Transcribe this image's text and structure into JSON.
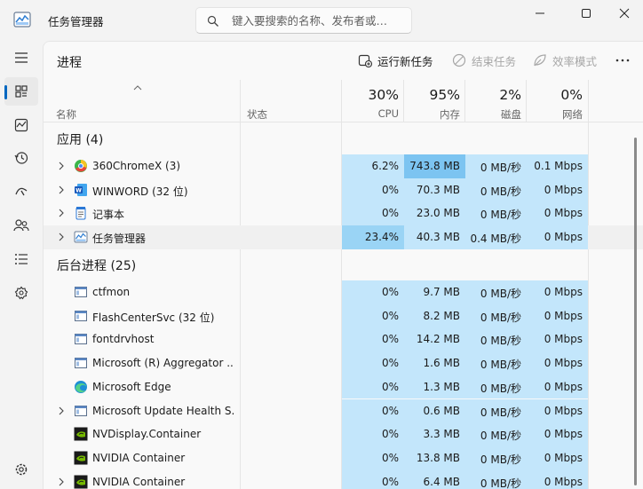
{
  "window": {
    "title": "任务管理器",
    "search_placeholder": "键入要搜索的名称、发布者或…"
  },
  "toolbar": {
    "page_title": "进程",
    "run_new_task": "运行新任务",
    "end_task": "结束任务",
    "efficiency_mode": "效率模式"
  },
  "columns": {
    "name": "名称",
    "status": "状态",
    "cpu": {
      "percent": "30%",
      "label": "CPU"
    },
    "memory": {
      "percent": "95%",
      "label": "内存"
    },
    "disk": {
      "percent": "2%",
      "label": "磁盘"
    },
    "network": {
      "percent": "0%",
      "label": "网络"
    }
  },
  "sections": {
    "apps": "应用 (4)",
    "background": "后台进程 (25)"
  },
  "apps": [
    {
      "name": "360ChromeX (3)",
      "icon": "chrome-360-icon",
      "expandable": true,
      "cpu": "6.2%",
      "memory": "743.8 MB",
      "disk": "0 MB/秒",
      "network": "0.1 Mbps"
    },
    {
      "name": "WINWORD (32 位)",
      "icon": "word-icon",
      "expandable": true,
      "cpu": "0%",
      "memory": "70.3 MB",
      "disk": "0 MB/秒",
      "network": "0 Mbps"
    },
    {
      "name": "记事本",
      "icon": "notepad-icon",
      "expandable": true,
      "cpu": "0%",
      "memory": "23.0 MB",
      "disk": "0 MB/秒",
      "network": "0 Mbps"
    },
    {
      "name": "任务管理器",
      "icon": "task-manager-icon",
      "expandable": true,
      "cpu": "23.4%",
      "memory": "40.3 MB",
      "disk": "0.4 MB/秒",
      "network": "0 Mbps"
    }
  ],
  "background": [
    {
      "name": "ctfmon",
      "icon": "process-icon",
      "expandable": false,
      "cpu": "0%",
      "memory": "9.7 MB",
      "disk": "0 MB/秒",
      "network": "0 Mbps"
    },
    {
      "name": "FlashCenterSvc (32 位)",
      "icon": "process-icon",
      "expandable": false,
      "cpu": "0%",
      "memory": "8.2 MB",
      "disk": "0 MB/秒",
      "network": "0 Mbps"
    },
    {
      "name": "fontdrvhost",
      "icon": "process-icon",
      "expandable": false,
      "cpu": "0%",
      "memory": "14.2 MB",
      "disk": "0 MB/秒",
      "network": "0 Mbps"
    },
    {
      "name": "Microsoft (R) Aggregator ...",
      "icon": "process-icon",
      "expandable": false,
      "cpu": "0%",
      "memory": "1.6 MB",
      "disk": "0 MB/秒",
      "network": "0 Mbps"
    },
    {
      "name": "Microsoft Edge",
      "icon": "edge-icon",
      "expandable": false,
      "cpu": "0%",
      "memory": "1.3 MB",
      "disk": "0 MB/秒",
      "network": "0 Mbps"
    },
    {
      "name": "Microsoft Update Health S...",
      "icon": "process-icon",
      "expandable": true,
      "cpu": "0%",
      "memory": "0.6 MB",
      "disk": "0 MB/秒",
      "network": "0 Mbps"
    },
    {
      "name": "NVDisplay.Container",
      "icon": "nvidia-icon",
      "expandable": false,
      "cpu": "0%",
      "memory": "3.3 MB",
      "disk": "0 MB/秒",
      "network": "0 Mbps"
    },
    {
      "name": "NVIDIA Container",
      "icon": "nvidia-icon",
      "expandable": false,
      "cpu": "0%",
      "memory": "13.8 MB",
      "disk": "0 MB/秒",
      "network": "0 Mbps"
    },
    {
      "name": "NVIDIA Container",
      "icon": "nvidia-icon",
      "expandable": true,
      "cpu": "0%",
      "memory": "6.4 MB",
      "disk": "0 MB/秒",
      "network": "0 Mbps"
    }
  ],
  "colors": {
    "heat_light": "#fff4c4",
    "heat_cpu_high": "#9ad4f5",
    "heat_mem_high": "#7cc4f1",
    "heat_base": "#c3e6fb",
    "accent": "#0067c0"
  }
}
